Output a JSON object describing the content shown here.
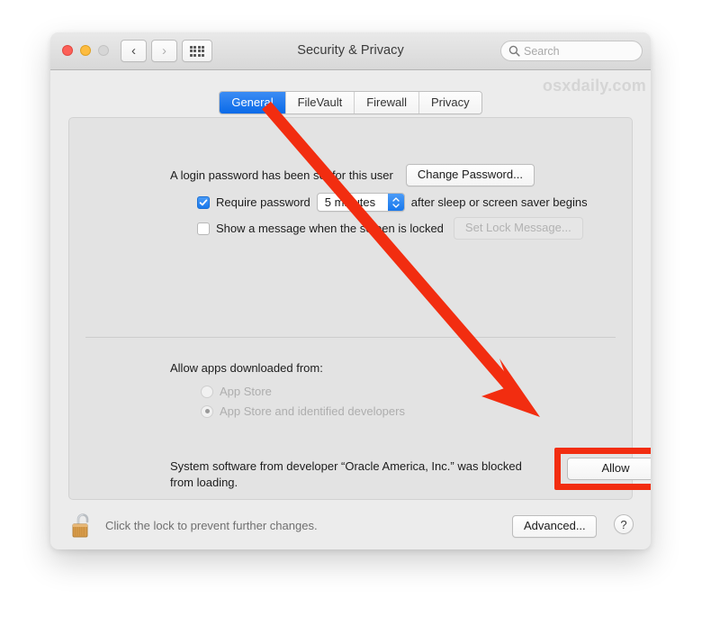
{
  "window": {
    "title": "Security & Privacy",
    "traffic_lights": [
      "close",
      "minimize",
      "zoom"
    ],
    "nav": {
      "back_icon": "chevron-left-icon",
      "forward_icon": "chevron-right-icon",
      "grid_icon": "show-all-grid-icon"
    },
    "search": {
      "placeholder": "Search",
      "icon": "search-icon"
    }
  },
  "watermark": "osxdaily.com",
  "tabs": [
    {
      "label": "General",
      "active": true
    },
    {
      "label": "FileVault",
      "active": false
    },
    {
      "label": "Firewall",
      "active": false
    },
    {
      "label": "Privacy",
      "active": false
    }
  ],
  "general": {
    "login_password_text": "A login password has been set for this user",
    "change_password_button": "Change Password...",
    "require_password": {
      "checked": true,
      "label": "Require password",
      "delay_value": "5 minutes",
      "suffix": "after sleep or screen saver begins"
    },
    "lock_message": {
      "checked": false,
      "label": "Show a message when the screen is locked",
      "button": "Set Lock Message...",
      "button_disabled": true
    },
    "allow_apps_heading": "Allow apps downloaded from:",
    "allow_apps_options": [
      {
        "label": "App Store",
        "selected": false,
        "disabled": true
      },
      {
        "label": "App Store and identified developers",
        "selected": true,
        "disabled": true
      }
    ],
    "blocked_message_line1": "System software from developer “Oracle America, Inc.” was blocked",
    "blocked_message_line2": "from loading.",
    "allow_button": "Allow"
  },
  "bottom": {
    "lock_icon": "unlocked-padlock-icon",
    "lock_hint": "Click the lock to prevent further changes.",
    "advanced_button": "Advanced...",
    "help_button": "?"
  },
  "annotation": {
    "arrow_color": "#f22d10",
    "highlight_color": "#f22d10",
    "arrow_from": "General tab area",
    "arrow_to": "Allow button"
  },
  "colors": {
    "accent_blue": "#1878ec",
    "window_bg": "#ececec",
    "panel_bg": "#e3e3e3",
    "annotation_red": "#f22d10"
  }
}
